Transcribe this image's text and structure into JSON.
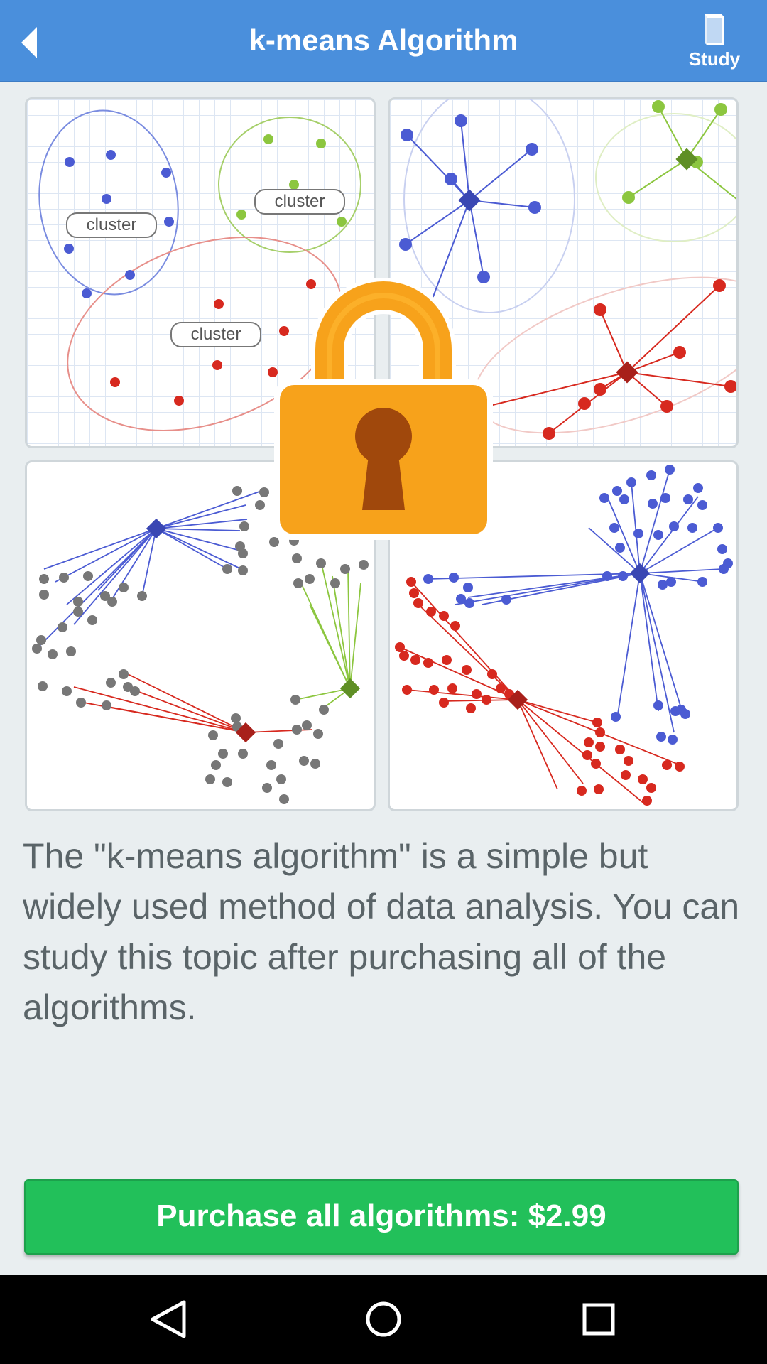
{
  "header": {
    "title": "k-means Algorithm",
    "study_label": "Study",
    "back_icon": "chevron-left-icon",
    "study_icon": "book-icon"
  },
  "panels": {
    "panel1": {
      "cluster_labels": [
        "cluster",
        "cluster",
        "cluster"
      ]
    }
  },
  "overlay": {
    "lock_icon": "padlock-icon",
    "lock_color": "#f7a21b"
  },
  "description": "The \"k-means algorithm\" is a simple but widely used method of data analysis. You can study this topic after purchasing all of the algorithms.",
  "purchase": {
    "label": "Purchase all algorithms: $2.99",
    "color": "#22c05a"
  },
  "navbar": {
    "back_icon": "triangle-back-icon",
    "home_icon": "circle-home-icon",
    "recents_icon": "square-recents-icon"
  },
  "colors": {
    "accent": "#4a8fdc",
    "blue_cluster": "#4b5bd3",
    "green_cluster": "#8cc63f",
    "red_cluster": "#d7291f",
    "unassigned": "#777777"
  }
}
